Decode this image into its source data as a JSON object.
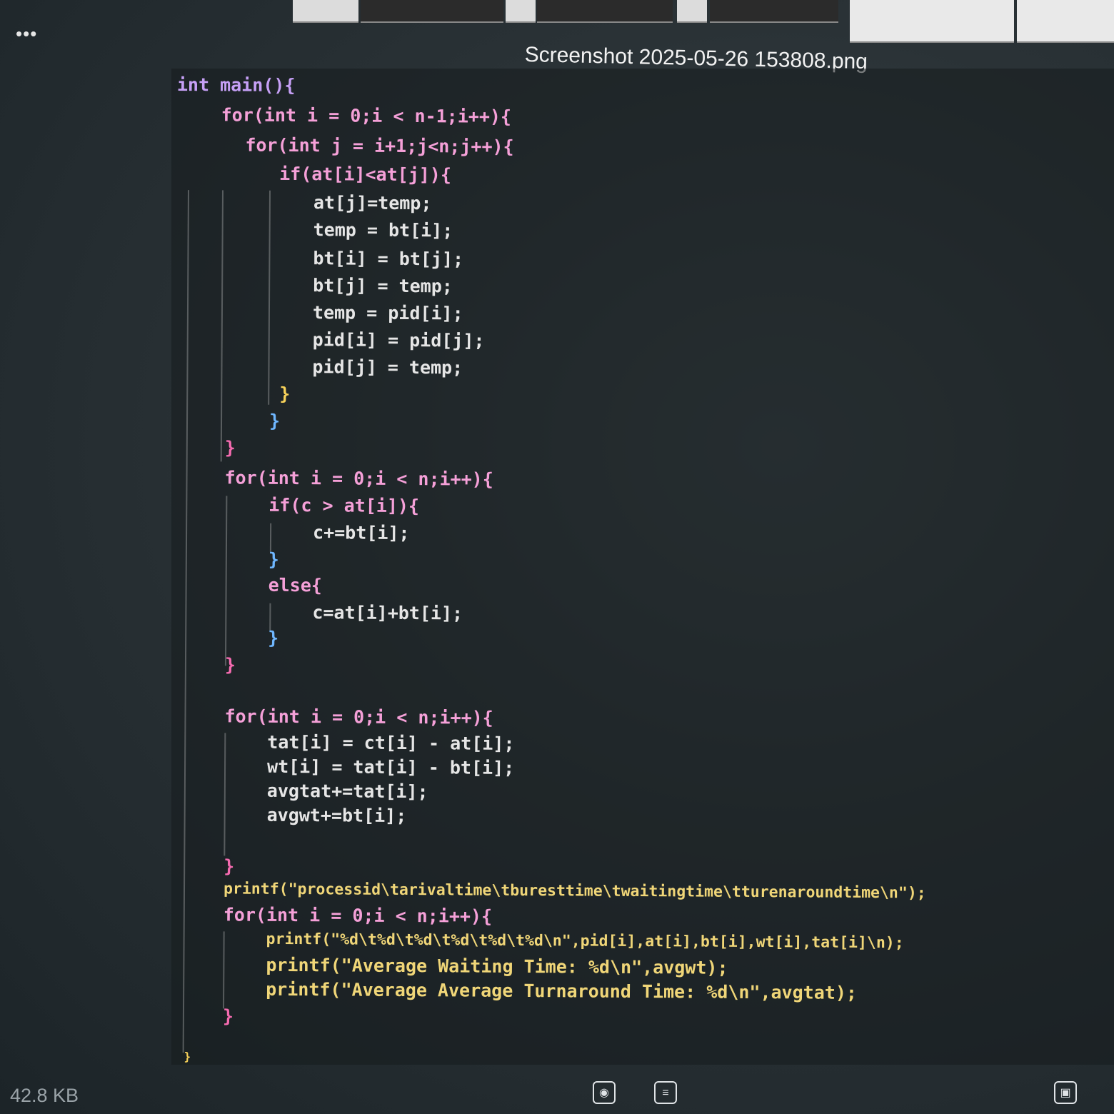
{
  "window": {
    "title": "Screenshot 2025-05-26 153808.png",
    "more_label": "•••",
    "file_size": "42.8 KB"
  },
  "toolbar": {
    "buttons": [
      {
        "icon": "visual-search-icon"
      },
      {
        "icon": "text-extract-icon"
      },
      {
        "icon": "screen-capture-icon"
      }
    ]
  },
  "code": {
    "lines": [
      "int main(){",
      "for(int i = 0;i < n-1;i++){",
      "for(int j = i+1;j<n;j++){",
      "if(at[i]<at[j]){",
      "at[j]=temp;",
      "temp = bt[i];",
      "bt[i] = bt[j];",
      "bt[j] = temp;",
      "temp = pid[i];",
      "pid[i] = pid[j];",
      "pid[j] = temp;",
      "}",
      "}",
      "}",
      "for(int i = 0;i < n;i++){",
      "if(c > at[i]){",
      "c+=bt[i];",
      "}",
      "else{",
      "c=at[i]+bt[i];",
      "}",
      "}",
      "for(int i = 0;i < n;i++){",
      "tat[i] = ct[i] - at[i];",
      "wt[i] = tat[i] - bt[i];",
      "avgtat+=tat[i];",
      "avgwt+=bt[i];",
      "}",
      "printf(\"processid\\tarivaltime\\tburesttime\\twaitingtime\\tturenaroundtime\\n\");",
      "for(int i = 0;i < n;i++){",
      "printf(\"%d\\t%d\\t%d\\t%d\\t%d\\t%d\\n\",pid[i],at[i],bt[i],wt[i],tat[i]\\n);",
      "printf(\"Average Waiting Time: %d\\n\",avgwt);",
      "printf(\"Average Average Turnaround Time: %d\\n\",avgtat);",
      "}",
      "}"
    ]
  }
}
